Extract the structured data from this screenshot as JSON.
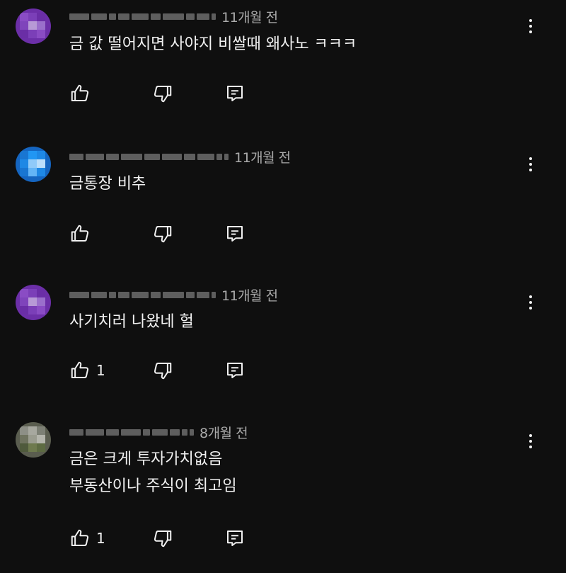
{
  "comments": [
    {
      "time": "11개월 전",
      "text": "금 값 떨어지면 사야지 비쌀때 왜사노 ㅋㅋㅋ",
      "likes": "",
      "avatar_color": "#7b3fb8"
    },
    {
      "time": "11개월 전",
      "text": "금통장  비추",
      "likes": "",
      "avatar_color": "#1e88e5"
    },
    {
      "time": "11개월 전",
      "text": "사기치러 나왔네 헐",
      "likes": "1",
      "avatar_color": "#7b3fb8"
    },
    {
      "time": "8개월 전",
      "text_line1": "금은 크게 투자가치없음",
      "text_line2": "부동산이나 주식이 최고임",
      "likes": "1",
      "avatar_color": "#6b6e5f"
    }
  ],
  "icons": {
    "like": "thumbs-up-icon",
    "dislike": "thumbs-down-icon",
    "reply": "reply-icon",
    "menu": "more-vert-icon"
  }
}
